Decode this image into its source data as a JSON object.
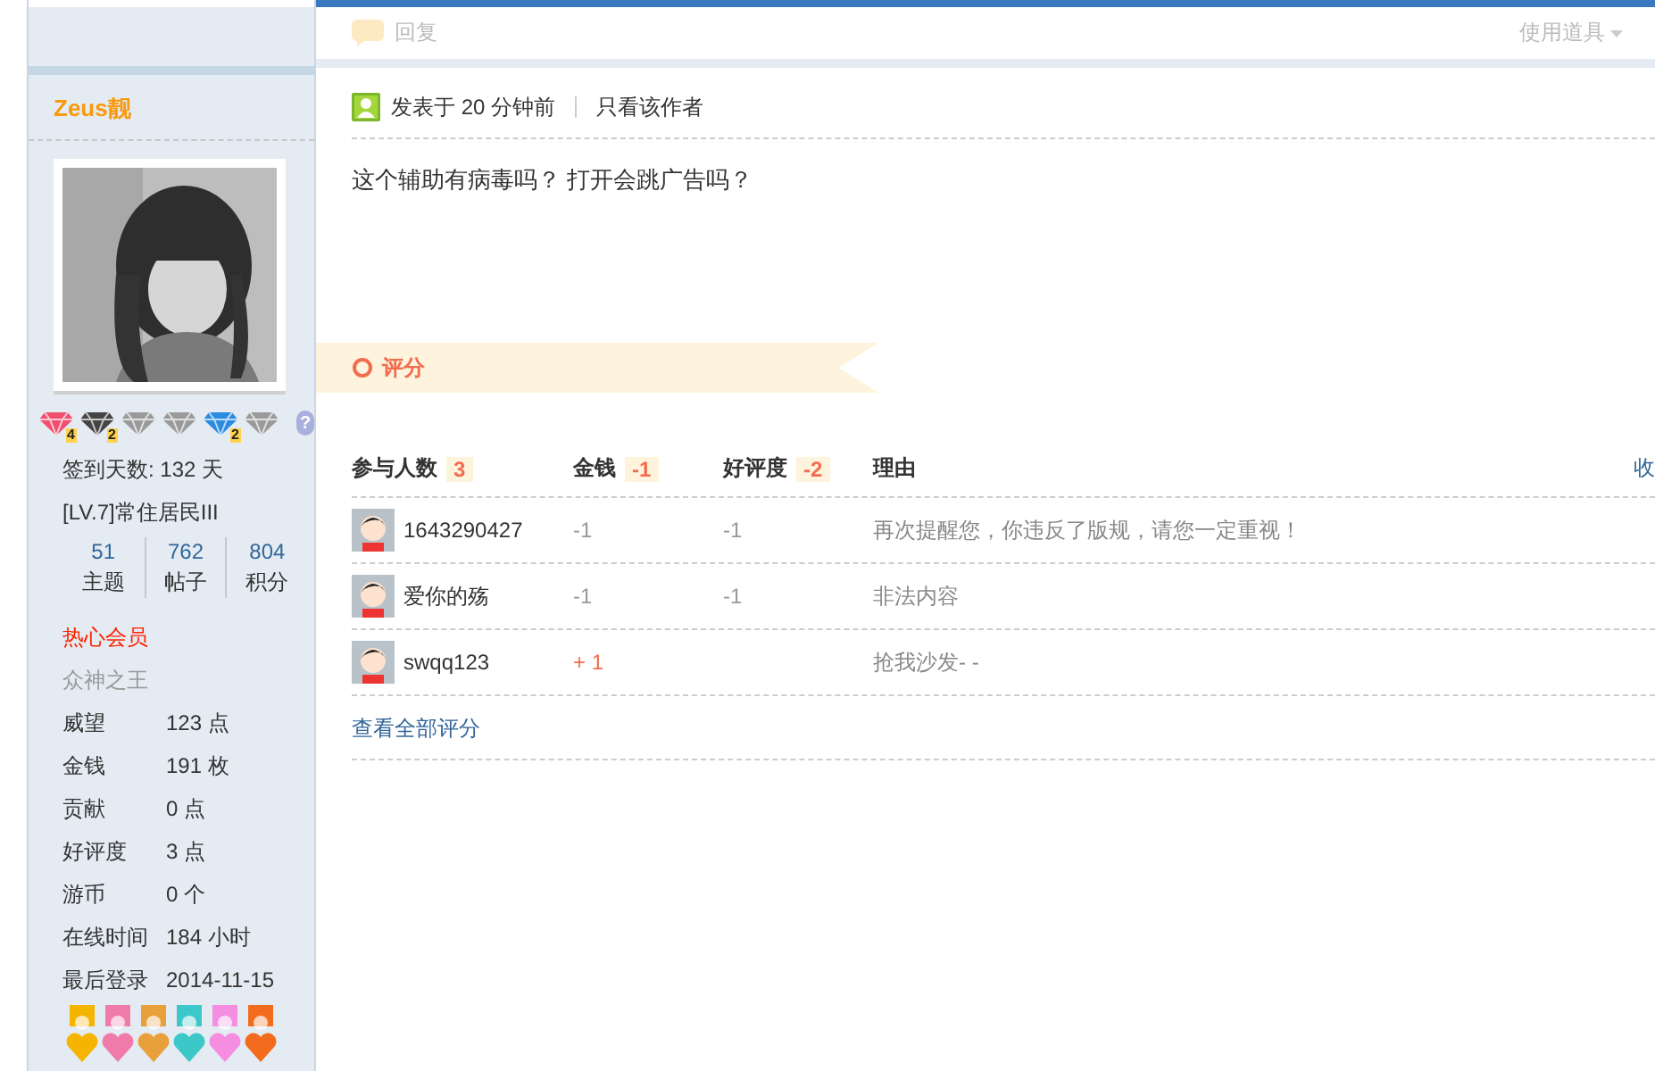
{
  "reply_bar": {
    "reply": "回复",
    "tools": "使用道具"
  },
  "sidebar": {
    "username": "Zeus靓",
    "badges": [
      {
        "kind": "gem",
        "color": "#f0506e",
        "count": "4"
      },
      {
        "kind": "gem",
        "color": "#444444",
        "count": "2"
      },
      {
        "kind": "gem",
        "color": "#9a9a9a"
      },
      {
        "kind": "gem",
        "color": "#9a9a9a"
      },
      {
        "kind": "gem",
        "color": "#2a8be0",
        "count": "2"
      },
      {
        "kind": "gem",
        "color": "#9a9a9a"
      },
      {
        "kind": "help",
        "color": "#a9b0de",
        "label": "?"
      }
    ],
    "signin": "签到天数: 132 天",
    "level": "[LV.7]常住居民III",
    "counts": [
      {
        "value": "51",
        "label": "主题"
      },
      {
        "value": "762",
        "label": "帖子"
      },
      {
        "value": "804",
        "label": "积分"
      }
    ],
    "group": "热心会员",
    "title": "众神之王",
    "fields": [
      {
        "label": "威望",
        "value": "123 点"
      },
      {
        "label": "金钱",
        "value": "191 枚"
      },
      {
        "label": "贡献",
        "value": "0 点"
      },
      {
        "label": "好评度",
        "value": "3 点"
      },
      {
        "label": "游币",
        "value": "0 个"
      },
      {
        "label": "在线时间",
        "value": "184 小时"
      },
      {
        "label": "最后登录",
        "value": "2014-11-15"
      }
    ],
    "medals": [
      {
        "color": "#f5b400"
      },
      {
        "color": "#f07aa8"
      },
      {
        "color": "#e8a13a"
      },
      {
        "color": "#3cc8c8"
      },
      {
        "color": "#f58ee0"
      },
      {
        "color": "#f36b1c"
      }
    ]
  },
  "post": {
    "posted": "发表于 20 分钟前",
    "only_author": "只看该作者",
    "body": "这个辅助有病毒吗？ 打开会跳广告吗？"
  },
  "rating": {
    "title": "评分",
    "headers": [
      {
        "label": "参与人数",
        "total": "3"
      },
      {
        "label": "金钱",
        "total": "-1"
      },
      {
        "label": "好评度",
        "total": "-2"
      },
      {
        "label": "理由"
      }
    ],
    "collapse": "收",
    "rows": [
      {
        "user": "1643290427",
        "money": {
          "text": "-1",
          "kind": "loss"
        },
        "rep": {
          "text": "-1",
          "kind": "loss"
        },
        "reason": "再次提醒您，你违反了版规，请您一定重视！"
      },
      {
        "user": "爱你的殇",
        "money": {
          "text": "-1",
          "kind": "loss"
        },
        "rep": {
          "text": "-1",
          "kind": "loss"
        },
        "reason": "非法内容"
      },
      {
        "user": "swqq123",
        "money": {
          "text": "+ 1",
          "kind": "gain"
        },
        "reason": "抢我沙发- -"
      }
    ],
    "view_all": "查看全部评分"
  }
}
